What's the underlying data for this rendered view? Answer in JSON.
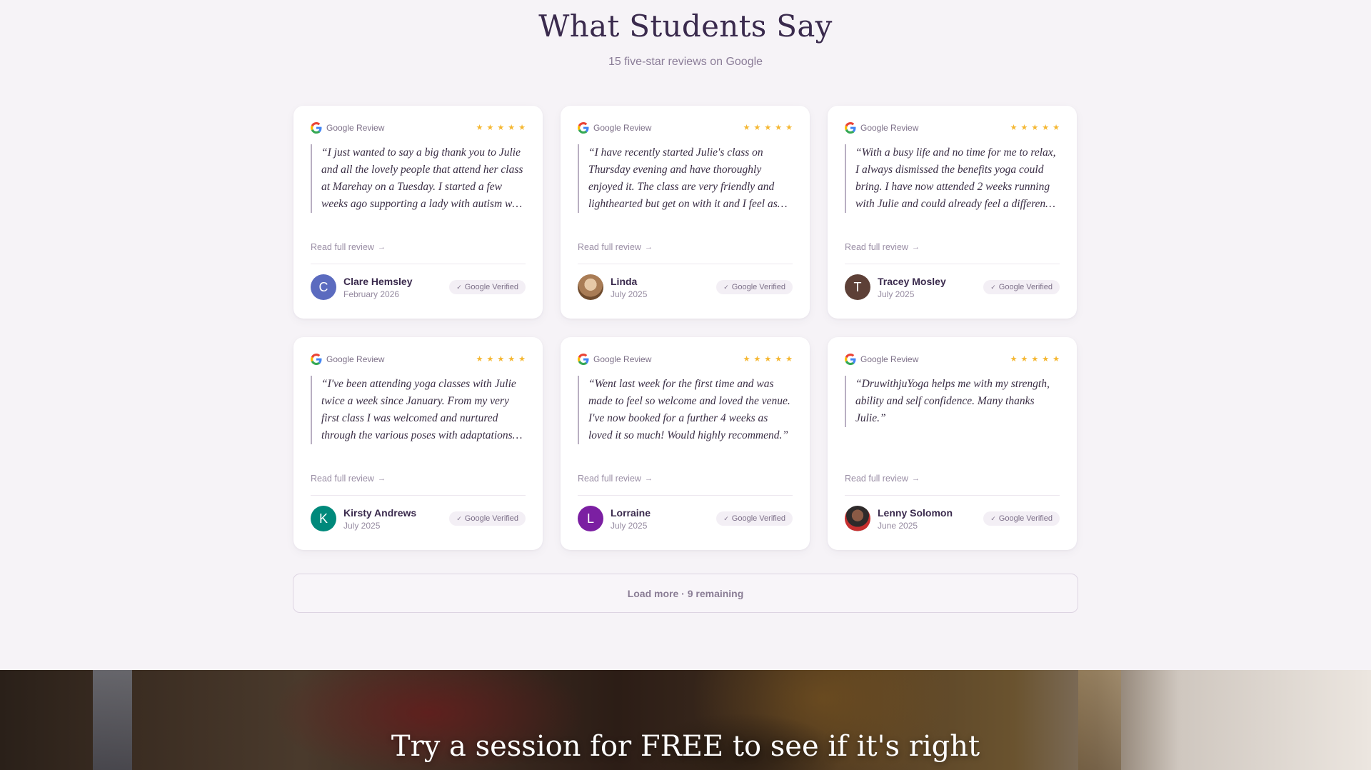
{
  "section": {
    "title": "What Students Say",
    "subtitle": "15 five-star reviews on Google"
  },
  "labels": {
    "source": "Google Review",
    "read_more": "Read full review",
    "verified": "Google Verified"
  },
  "reviews": [
    {
      "rating": 5,
      "quote": "“I just wanted to say a big thank you to Julie and all the lovely people that attend her class at Marehay on a Tuesday. I started a few weeks ago supporting a lady with autism who said s…",
      "author": "Clare Hemsley",
      "date": "February 2026",
      "avatar_letter": "C",
      "avatar_color": "#5b6bbf"
    },
    {
      "rating": 5,
      "quote": "“I have recently started Julie's class on Thursday evening and have thoroughly enjoyed it. The class are very friendly and lighthearted but get on with it and I feel as…",
      "author": "Linda",
      "date": "July 2025",
      "avatar_letter": "",
      "avatar_color": "#a97c55"
    },
    {
      "rating": 5,
      "quote": "“With a busy life and no time for me to relax, I always dismissed the benefits yoga could bring. I have now attended 2 weeks running with Julie and could already feel a difference in th…",
      "author": "Tracey Mosley",
      "date": "July 2025",
      "avatar_letter": "T",
      "avatar_color": "#5d4037"
    },
    {
      "rating": 5,
      "quote": "“I've been attending yoga classes with Julie twice a week since January. From my very first class I was welcomed and nurtured through the various poses with adaptations given for…",
      "author": "Kirsty Andrews",
      "date": "July 2025",
      "avatar_letter": "K",
      "avatar_color": "#00897b"
    },
    {
      "rating": 5,
      "quote": "“Went last week for the first time and was made to feel so welcome and loved the venue. I've now booked for a further 4 weeks as loved it so much! Would highly recommend.”",
      "author": "Lorraine",
      "date": "July 2025",
      "avatar_letter": "L",
      "avatar_color": "#7b1fa2"
    },
    {
      "rating": 5,
      "quote": "“DruwithjuYoga helps me with my strength, ability and self confidence. Many thanks Julie.”",
      "author": "Lenny Solomon",
      "date": "June 2025",
      "avatar_letter": "",
      "avatar_color": "#2e2a2a"
    }
  ],
  "load_more": {
    "label": "Load more · 9 remaining"
  },
  "cta": {
    "title": "Try a session for FREE to see if it's right"
  },
  "colors": {
    "background": "#f6f3f7",
    "heading": "#3a2a4d",
    "star": "#f5b731"
  }
}
